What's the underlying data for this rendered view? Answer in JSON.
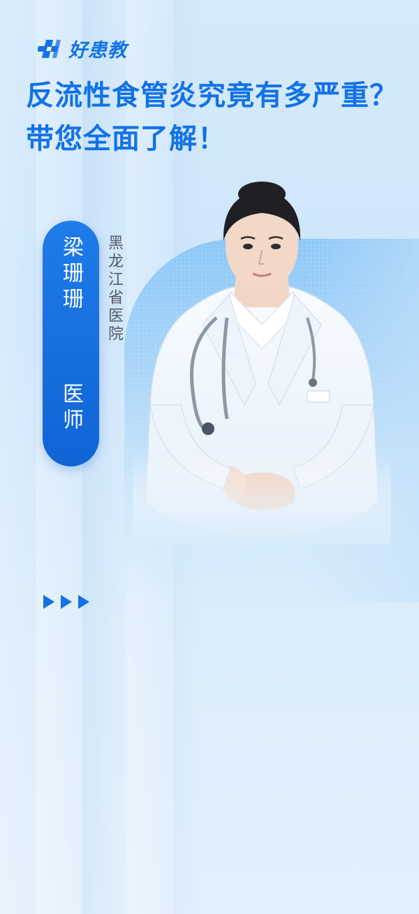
{
  "brand": {
    "name": "好患教",
    "color": "#1272e6",
    "logo_icon": "medical-cross-logo-icon"
  },
  "headline": "反流性食管炎究竟有多严重？带您全面了解！",
  "doctor": {
    "name": "梁珊珊",
    "title": "医师",
    "hospital": "黑龙江省医院"
  },
  "decor": {
    "arrow_icon": "triangle-right-icon",
    "arrow_count": 3,
    "accent": "#1272e6"
  }
}
